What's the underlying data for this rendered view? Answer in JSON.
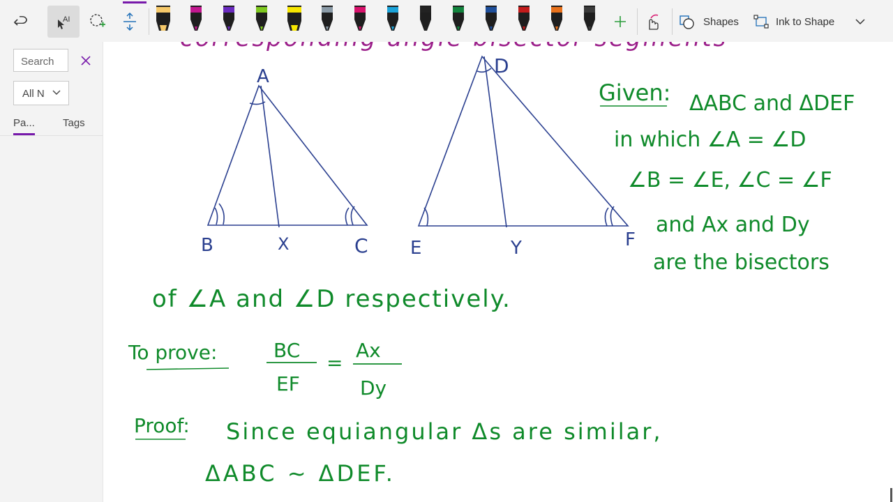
{
  "toolbar": {
    "shapes_label": "Shapes",
    "ink_to_shape_label": "Ink to Shape",
    "pen_colors": [
      "#f6c96a",
      "#c2178f",
      "#6a2bbf",
      "#7ec81f",
      "#f7e600",
      "#8a9aa6",
      "#d8126c",
      "#1ba3d9",
      "#222222",
      "#12833d",
      "#1f4f9a",
      "#c21b1b",
      "#e8711b",
      "#3a3a3a"
    ],
    "accent_color": "#7719aa"
  },
  "sidebar": {
    "search_placeholder": "Search",
    "filter_value": "All N",
    "tabs": [
      {
        "label": "Pa..."
      },
      {
        "label": "Tags"
      }
    ]
  },
  "page": {
    "ink_color": "#0f8a2a",
    "diagram_color": "#2a3f8f",
    "header_partial": "corresponding angle bisector segments",
    "triangle1_labels": {
      "top": "A",
      "left": "B",
      "mid": "X",
      "right": "C"
    },
    "triangle2_labels": {
      "top": "D",
      "left": "E",
      "mid": "Y",
      "right": "F"
    },
    "given_label": "Given:",
    "given_lines": [
      "ΔABC and ΔDEF",
      "in which ∠A = ∠D",
      "∠B = ∠E,  ∠C = ∠F",
      "and  Ax  and Dy",
      "are the bisectors"
    ],
    "continuation": "of ∠A and ∠D respectively.",
    "to_prove_label": "To prove:",
    "fraction_left": {
      "num": "BC",
      "den": "EF"
    },
    "fraction_right": {
      "num": "Ax",
      "den": "Dy"
    },
    "proof_label": "Proof:",
    "proof_lines": [
      "Since equiangular Δs are similar,",
      "ΔABC ~ ΔDEF."
    ]
  }
}
